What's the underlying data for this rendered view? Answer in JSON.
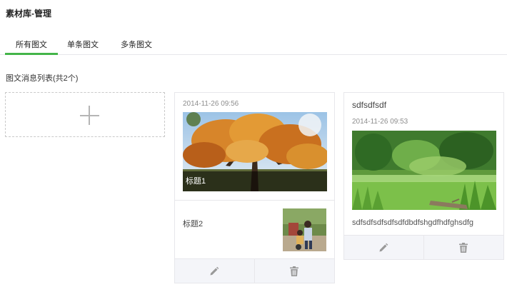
{
  "header": {
    "title": "素材库-管理"
  },
  "tabs": [
    {
      "label": "所有图文",
      "active": true
    },
    {
      "label": "单条图文",
      "active": false
    },
    {
      "label": "多条图文",
      "active": false
    }
  ],
  "list": {
    "count_label": "图文消息列表(共2个)"
  },
  "add_card": {
    "icon": "plus-icon"
  },
  "messages": [
    {
      "type": "multi",
      "time": "2014-11-26 09:56",
      "main_article": {
        "title": "标题1",
        "cover": "autumn-tree-photo"
      },
      "sub_articles": [
        {
          "title": "标题2",
          "thumb": "people-photo"
        }
      ],
      "actions": {
        "edit_icon": "pencil-icon",
        "delete_icon": "trash-icon"
      }
    },
    {
      "type": "single",
      "title": "sdfsdfsdf",
      "time": "2014-11-26 09:53",
      "cover": "grass-field-photo",
      "digest": "sdfsdfsdfsdfsdfdbdfshgdfhdfghsdfg",
      "actions": {
        "edit_icon": "pencil-icon",
        "delete_icon": "trash-icon"
      }
    }
  ],
  "colors": {
    "accent": "#44b549",
    "border": "#e7e7eb",
    "action_bg": "#f4f5f9",
    "icon": "#999999"
  }
}
